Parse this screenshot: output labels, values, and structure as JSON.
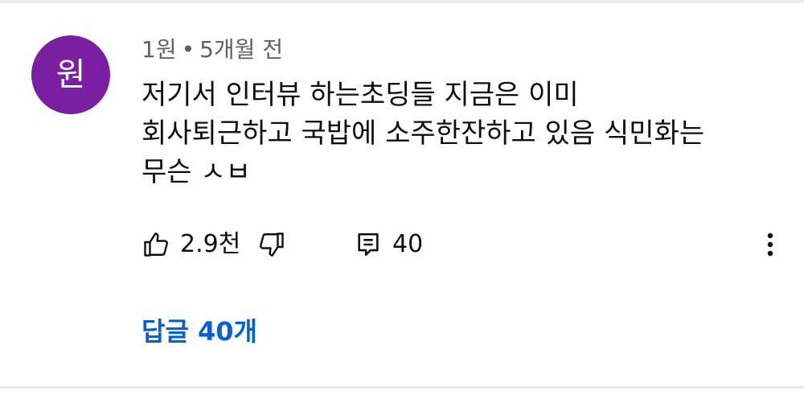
{
  "comment": {
    "avatar_letter": "원",
    "avatar_color": "#7b1fa2",
    "author": "1원",
    "separator": "•",
    "timestamp": "5개월 전",
    "text": "저기서 인터뷰 하는초딩들 지금은 이미\n회사퇴근하고 국밥에 소주한잔하고 있음 식민화는\n무슨 ㅅㅂ"
  },
  "actions": {
    "like_icon": "thumbs-up-icon",
    "like_count": "2.9천",
    "dislike_icon": "thumbs-down-icon",
    "reply_icon": "comment-icon",
    "reply_count": "40",
    "more_icon": "more-vertical-icon"
  },
  "replies": {
    "label": "답글 40개",
    "color": "#065fd4"
  }
}
